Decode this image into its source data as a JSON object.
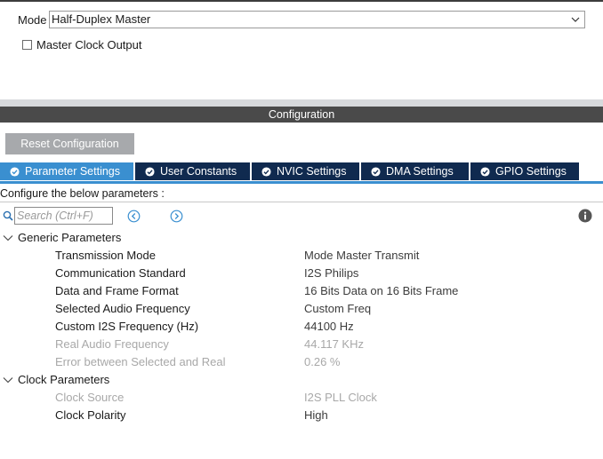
{
  "mode": {
    "label": "Mode",
    "value": "Half-Duplex Master"
  },
  "master_clock_output": {
    "label": "Master Clock Output",
    "checked": false
  },
  "configuration": {
    "header": "Configuration",
    "reset_button": "Reset Configuration",
    "tabs": [
      {
        "label": "Parameter Settings",
        "active": true
      },
      {
        "label": "User Constants",
        "active": false
      },
      {
        "label": "NVIC Settings",
        "active": false
      },
      {
        "label": "DMA Settings",
        "active": false
      },
      {
        "label": "GPIO Settings",
        "active": false
      }
    ],
    "instructions": "Configure the below parameters :",
    "search_placeholder": "Search (Ctrl+F)"
  },
  "groups": [
    {
      "name": "Generic Parameters",
      "params": [
        {
          "name": "Transmission Mode",
          "value": "Mode Master Transmit",
          "enabled": true
        },
        {
          "name": "Communication Standard",
          "value": "I2S Philips",
          "enabled": true
        },
        {
          "name": "Data and Frame Format",
          "value": "16 Bits Data on 16 Bits Frame",
          "enabled": true
        },
        {
          "name": "Selected Audio Frequency",
          "value": "Custom Freq",
          "enabled": true
        },
        {
          "name": "Custom I2S Frequency (Hz)",
          "value": "44100 Hz",
          "enabled": true
        },
        {
          "name": "Real Audio Frequency",
          "value": "44.117 KHz",
          "enabled": false
        },
        {
          "name": "Error between Selected and Real",
          "value": "0.26 %",
          "enabled": false
        }
      ]
    },
    {
      "name": "Clock Parameters",
      "params": [
        {
          "name": "Clock Source",
          "value": "I2S PLL Clock",
          "enabled": false
        },
        {
          "name": "Clock Polarity",
          "value": "High",
          "enabled": true
        }
      ]
    }
  ],
  "colors": {
    "tab_active": "#3a8fd0",
    "tab_inactive": "#102a4f",
    "header_bg": "#4a4a4a",
    "reset_bg": "#a7a9ac",
    "disabled_text": "#a8a8a8"
  }
}
